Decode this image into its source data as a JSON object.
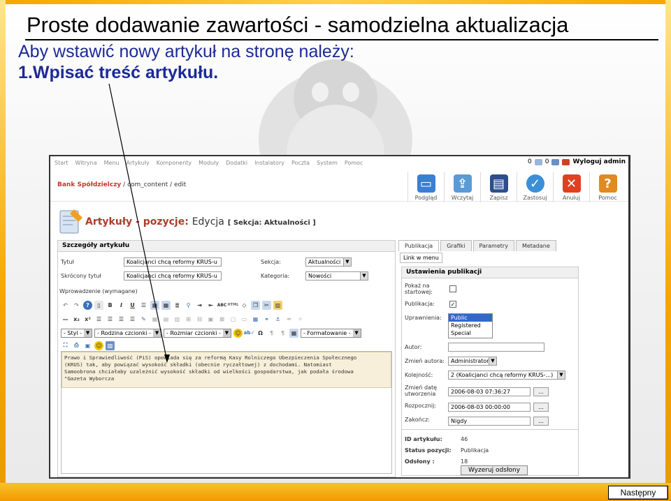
{
  "slide": {
    "title": "Proste dodawanie zawartości - samodzielna aktualizacja",
    "subtitle": "Aby wstawić nowy artykuł na stronę należy:",
    "step": "1.Wpisać treść artykułu.",
    "next_button": "Następny"
  },
  "cms": {
    "menu": [
      "Start",
      "Witryna",
      "Menu",
      "Artykuły",
      "Komponenty",
      "Moduły",
      "Dodatki",
      "Instalatory",
      "Poczta",
      "System",
      "Pomoc"
    ],
    "counter_a": "0",
    "counter_b": "0",
    "logout": "Wyloguj admin",
    "breadcrumb_org": "Bank Spółdzielczy",
    "breadcrumb_path": " / com_content / edit",
    "toolbar": [
      {
        "label": "Podgląd",
        "icon": "preview-icon",
        "color": "#3b7fd4"
      },
      {
        "label": "Wczytaj",
        "icon": "upload-icon",
        "color": "#5b9bd5"
      },
      {
        "label": "Zapisz",
        "icon": "save-icon",
        "color": "#2c4f8c"
      },
      {
        "label": "Zastosuj",
        "icon": "apply-icon",
        "color": "#3b8fd8"
      },
      {
        "label": "Anuluj",
        "icon": "cancel-icon",
        "color": "#e04020"
      },
      {
        "label": "Pomoc",
        "icon": "help-icon",
        "color": "#e08a20"
      }
    ],
    "page_title_main": "Artykuły - pozycje:",
    "page_title_edit": "Edycja",
    "page_title_section": "[ Sekcja: Aktualności ]",
    "details": {
      "header": "Szczegóły artykułu",
      "title_label": "Tytuł",
      "title_value": "Koalicjanci chcą reformy KRUS-u",
      "alias_label": "Skrócony tytuł",
      "alias_value": "Koalicjanci chcą reformy KRUS-u",
      "section_label": "Sekcja:",
      "section_value": "Aktualności",
      "category_label": "Kategoria:",
      "category_value": "Nowości",
      "intro_label": "Wprowadzenie (wymagane)"
    },
    "editor": {
      "style": "- Styl -",
      "font_family": "- Rodzina czcionki -",
      "font_size": "- Rozmiar czcionki -",
      "format": "- Formatowanie -",
      "content": "Prawo i Sprawiedliwość (PiS) opowiada się za reformą Kasy Rolniczego Ubezpieczenia Społecznego\n(KRUS) tak, aby powiązać wysokość składki (obecnie ryczałtowej) z dochodami. Natomiast\nSamoobrona chciałaby uzależnić wysokość składki od wielkości gospodarstwa, jak podała środowa\n\"Gazeta Wyborcza"
    },
    "tabs": [
      "Publikacja",
      "Grafiki",
      "Parametry",
      "Metadane"
    ],
    "tab_link": "Link w menu",
    "publish": {
      "header": "Ustawienia publikacji",
      "frontpage_label": "Pokaż na startowej:",
      "frontpage_checked": false,
      "published_label": "Publikacja:",
      "published_checked": true,
      "access_label": "Uprawnienia:",
      "access_options": [
        "Public",
        "Registered",
        "Special"
      ],
      "author_label": "Autor:",
      "author_value": "",
      "change_author_label": "Zmień autora:",
      "change_author_value": "Administrator",
      "order_label": "Kolejność:",
      "order_value": "2 (Koalicjanci chcą reformy KRUS-...)",
      "created_label": "Zmień datę utworzenia",
      "created_value": "2006-08-03 07:36:27",
      "start_label": "Rozpocznij:",
      "start_value": "2006-08-03 00:00:00",
      "end_label": "Zakończ:",
      "end_value": "Nigdy",
      "dots": "...",
      "id_label": "ID artykułu:",
      "id_value": "46",
      "status_label": "Status pozycji:",
      "status_value": "Publikacja",
      "hits_label": "Odsłony :",
      "hits_value": "18",
      "reset_button": "Wyzeruj odsłony"
    }
  },
  "colors": {
    "frame": "#f7a400",
    "subtitle_text": "#1c2a96",
    "cms_accent": "#b03b2a"
  }
}
